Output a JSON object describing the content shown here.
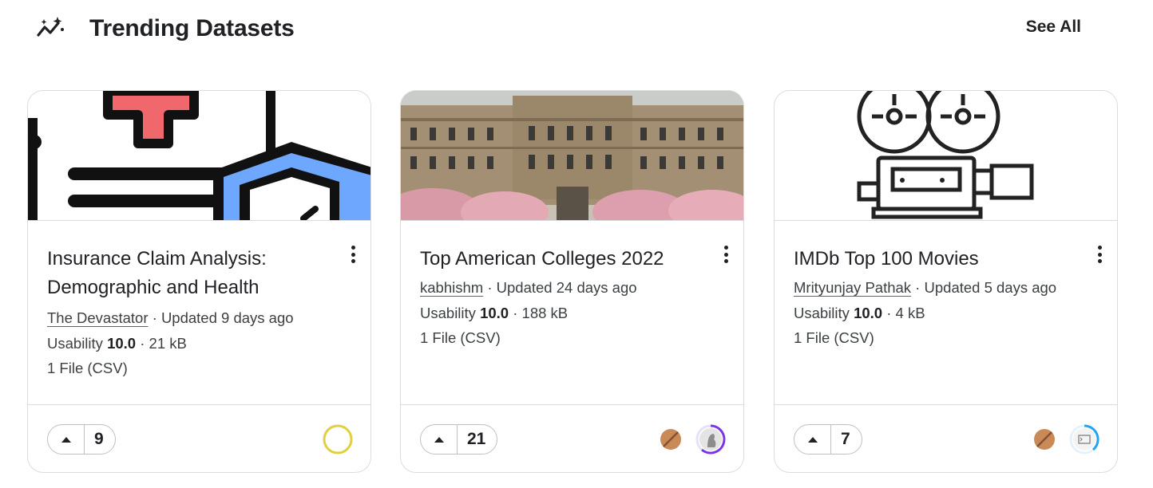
{
  "header": {
    "title": "Trending Datasets",
    "see_all": "See All",
    "icon": "trending-sparkle-icon"
  },
  "cards": [
    {
      "title": "Insurance Claim Analysis: Demographic and Health",
      "author": "The Devastator",
      "updated": "Updated 9 days ago",
      "usability_label": "Usability",
      "usability": "10.0",
      "size": "21 kB",
      "files": "1 File (CSV)",
      "votes": "9",
      "thumbnail": "insurance-health-icon-illustration",
      "avatars": [
        "yellow-ring-avatar"
      ]
    },
    {
      "title": "Top American Colleges 2022",
      "author": "kabhishm",
      "updated": "Updated 24 days ago",
      "usability_label": "Usability",
      "usability": "10.0",
      "size": "188 kB",
      "files": "1 File (CSV)",
      "votes": "21",
      "thumbnail": "college-building-photo",
      "avatars": [
        "bronze-medal-badge",
        "purple-ring-avatar"
      ]
    },
    {
      "title": "IMDb Top 100 Movies",
      "author": "Mrityunjay Pathak",
      "updated": "Updated 5 days ago",
      "usability_label": "Usability",
      "usability": "10.0",
      "size": "4 kB",
      "files": "1 File (CSV)",
      "votes": "7",
      "thumbnail": "film-projector-illustration",
      "avatars": [
        "bronze-medal-badge",
        "blue-ring-avatar"
      ]
    }
  ],
  "colors": {
    "border": "#dadce0",
    "text": "#202124",
    "insurance_red": "#f0686b",
    "insurance_blue": "#6ea8fe",
    "ring_yellow": "#e2cf3c",
    "ring_purple": "#7a35e8",
    "ring_blue": "#20a5f3",
    "medal_bronze": "#b07447"
  }
}
